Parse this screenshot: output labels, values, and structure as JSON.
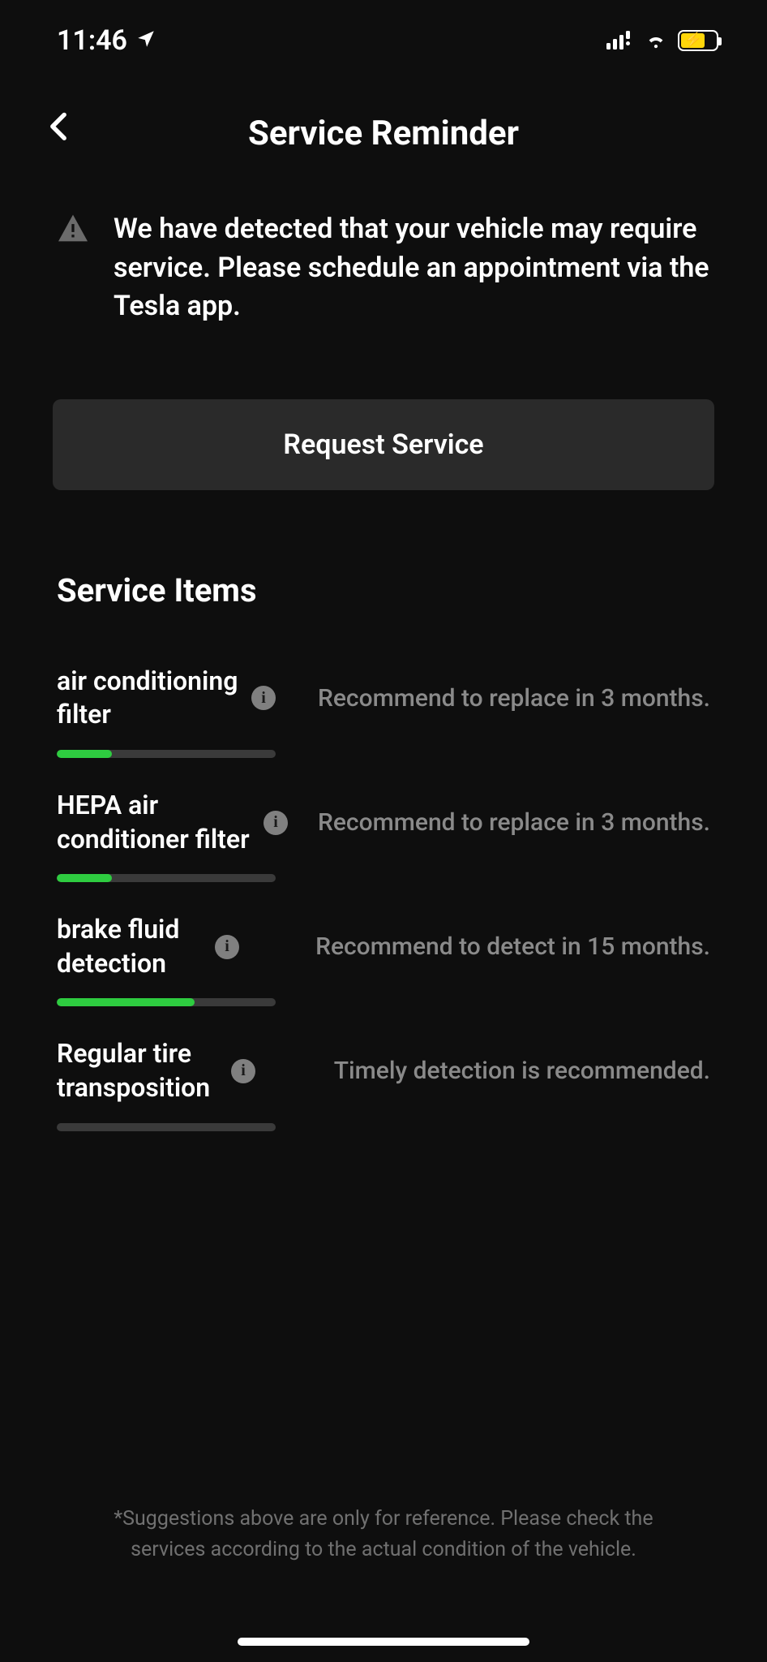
{
  "status": {
    "time": "11:46"
  },
  "header": {
    "title": "Service Reminder"
  },
  "alert": {
    "text": "We have detected that your vehicle may require service. Please schedule an appointment via the Tesla app."
  },
  "request_button": "Request Service",
  "section_title": "Service Items",
  "items": [
    {
      "name": "air conditioning filter",
      "recommendation": "Recommend to replace in 3 months.",
      "progress_percent": 25,
      "progress_color": "#2ecc40"
    },
    {
      "name": "HEPA air conditioner filter",
      "recommendation": "Recommend to replace in 3 months.",
      "progress_percent": 25,
      "progress_color": "#2ecc40"
    },
    {
      "name": "brake fluid detection",
      "recommendation": "Recommend to detect in 15 months.",
      "progress_percent": 63,
      "progress_color": "#2ecc40"
    },
    {
      "name": "Regular tire transposition",
      "recommendation": "Timely detection is recommended.",
      "progress_percent": 0,
      "progress_color": "#2ecc40"
    }
  ],
  "footnote": "*Suggestions above are only for reference. Please check the services according to the actual condition of the vehicle."
}
